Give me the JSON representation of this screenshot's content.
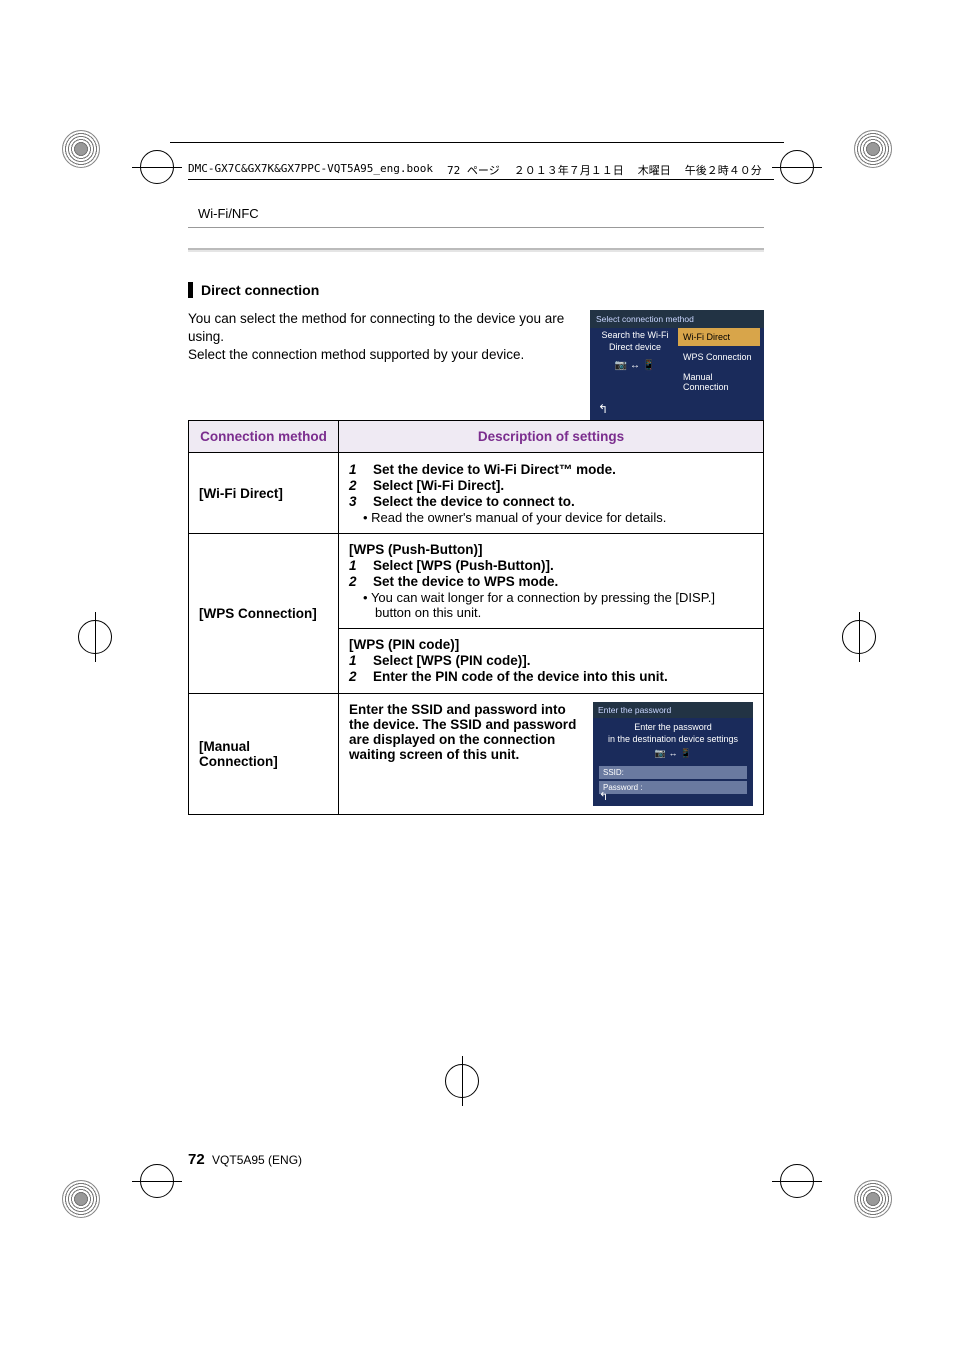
{
  "bookline": {
    "file": "DMC-GX7C&GX7K&GX7PPC-VQT5A95_eng.book",
    "page": "72 ページ",
    "date": "２０１３年７月１１日",
    "day": "木曜日",
    "time": "午後２時４０分"
  },
  "section_head": "Wi-Fi/NFC",
  "subhead": "Direct connection",
  "intro_line1": "You can select the method for connecting to the device you are using.",
  "intro_line2": "Select the connection method supported by your device.",
  "screen1": {
    "title": "Select connection method",
    "left1": "Search the Wi-Fi",
    "left2": "Direct device",
    "opt1": "Wi-Fi Direct",
    "opt2": "WPS Connection",
    "opt3": "Manual Connection"
  },
  "table": {
    "col1": "Connection method",
    "col2": "Description of settings",
    "row1_label": "[Wi-Fi Direct]",
    "row1_step1": "Set the device to Wi-Fi Direct™ mode.",
    "row1_step2": "Select [Wi-Fi Direct].",
    "row1_step3": "Select the device to connect to.",
    "row1_bullet": "Read the owner's manual of your device for details.",
    "row2_label": "[WPS Connection]",
    "row2a_head": "[WPS (Push-Button)]",
    "row2a_step1": "Select [WPS (Push-Button)].",
    "row2a_step2": "Set the device to WPS mode.",
    "row2a_bullet": "You can wait longer for a connection by pressing the [DISP.] button on this unit.",
    "row2b_head": "[WPS (PIN code)]",
    "row2b_step1": "Select [WPS (PIN code)].",
    "row2b_step2": "Enter the PIN code of the device into this unit.",
    "row3_label": "[Manual Connection]",
    "row3_text": "Enter the SSID and password into the device. The SSID and password are displayed on the connection waiting screen of this unit."
  },
  "screen2": {
    "title": "Enter the password",
    "line1": "Enter the password",
    "line2": "in the destination device settings",
    "ssid": "SSID:",
    "pass": "Password :"
  },
  "footer": {
    "page_number": "72",
    "code": "VQT5A95 (ENG)"
  }
}
